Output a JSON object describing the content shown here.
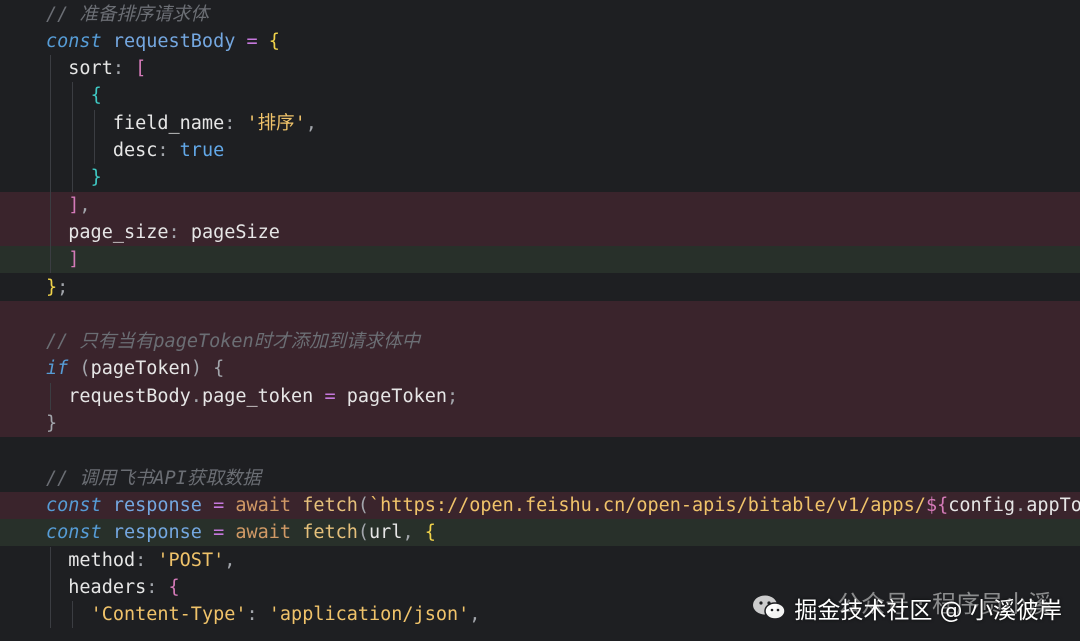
{
  "editor": {
    "lines": [
      {
        "diff": "none",
        "guides": 0,
        "tokens": [
          {
            "t": "// 准备排序请求体",
            "c": "comment"
          }
        ]
      },
      {
        "diff": "none",
        "guides": 0,
        "tokens": [
          {
            "t": "const ",
            "c": "keyword"
          },
          {
            "t": "requestBody",
            "c": "var-blue"
          },
          {
            "t": " = ",
            "c": "op"
          },
          {
            "t": "{",
            "c": "brace-gold"
          }
        ]
      },
      {
        "diff": "none",
        "guides": 1,
        "tokens": [
          {
            "t": "  sort",
            "c": "prop"
          },
          {
            "t": ": ",
            "c": "punct"
          },
          {
            "t": "[",
            "c": "brace-pink"
          }
        ]
      },
      {
        "diff": "none",
        "guides": 2,
        "tokens": [
          {
            "t": "    ",
            "c": "var"
          },
          {
            "t": "{",
            "c": "brace-teal"
          }
        ]
      },
      {
        "diff": "none",
        "guides": 3,
        "tokens": [
          {
            "t": "      field_name",
            "c": "prop"
          },
          {
            "t": ": ",
            "c": "punct"
          },
          {
            "t": "'排序'",
            "c": "string"
          },
          {
            "t": ",",
            "c": "punct"
          }
        ]
      },
      {
        "diff": "none",
        "guides": 3,
        "tokens": [
          {
            "t": "      desc",
            "c": "prop"
          },
          {
            "t": ": ",
            "c": "punct"
          },
          {
            "t": "true",
            "c": "bool"
          }
        ]
      },
      {
        "diff": "none",
        "guides": 2,
        "tokens": [
          {
            "t": "    ",
            "c": "var"
          },
          {
            "t": "}",
            "c": "brace-teal"
          }
        ]
      },
      {
        "diff": "del",
        "guides": 1,
        "tokens": [
          {
            "t": "  ",
            "c": "var"
          },
          {
            "t": "]",
            "c": "brace-pink"
          },
          {
            "t": ",",
            "c": "punct"
          }
        ]
      },
      {
        "diff": "del",
        "guides": 1,
        "tokens": [
          {
            "t": "  page_size",
            "c": "prop"
          },
          {
            "t": ": ",
            "c": "punct"
          },
          {
            "t": "pageSize",
            "c": "var"
          }
        ]
      },
      {
        "diff": "add",
        "guides": 1,
        "tokens": [
          {
            "t": "  ",
            "c": "var"
          },
          {
            "t": "]",
            "c": "brace-pink"
          }
        ]
      },
      {
        "diff": "none",
        "guides": 0,
        "tokens": [
          {
            "t": "}",
            "c": "brace-gold"
          },
          {
            "t": ";",
            "c": "punct"
          }
        ]
      },
      {
        "diff": "del",
        "guides": 0,
        "tokens": [
          {
            "t": "",
            "c": "var"
          }
        ]
      },
      {
        "diff": "del",
        "guides": 0,
        "tokens": [
          {
            "t": "// 只有当有pageToken时才添加到请求体中",
            "c": "comment"
          }
        ]
      },
      {
        "diff": "del",
        "guides": 0,
        "tokens": [
          {
            "t": "if",
            "c": "keyword"
          },
          {
            "t": " (",
            "c": "punct"
          },
          {
            "t": "pageToken",
            "c": "var"
          },
          {
            "t": ") ",
            "c": "punct"
          },
          {
            "t": "{",
            "c": "punct"
          }
        ]
      },
      {
        "diff": "del",
        "guides": 1,
        "tokens": [
          {
            "t": "  requestBody",
            "c": "var"
          },
          {
            "t": ".",
            "c": "punct"
          },
          {
            "t": "page_token",
            "c": "var"
          },
          {
            "t": " = ",
            "c": "op"
          },
          {
            "t": "pageToken",
            "c": "var"
          },
          {
            "t": ";",
            "c": "punct"
          }
        ]
      },
      {
        "diff": "del",
        "guides": 0,
        "tokens": [
          {
            "t": "}",
            "c": "punct"
          }
        ]
      },
      {
        "diff": "none",
        "guides": 0,
        "tokens": [
          {
            "t": "",
            "c": "var"
          }
        ]
      },
      {
        "diff": "none",
        "guides": 0,
        "tokens": [
          {
            "t": "// 调用飞书API获取数据",
            "c": "comment"
          }
        ]
      },
      {
        "diff": "del",
        "guides": 0,
        "tokens": [
          {
            "t": "const ",
            "c": "keyword"
          },
          {
            "t": "response",
            "c": "var-blue"
          },
          {
            "t": " = ",
            "c": "op"
          },
          {
            "t": "await ",
            "c": "kw-await"
          },
          {
            "t": "fetch",
            "c": "fn"
          },
          {
            "t": "(",
            "c": "punct"
          },
          {
            "t": "`https://open.feishu.cn/open-apis/bitable/v1/apps/",
            "c": "url"
          },
          {
            "t": "${",
            "c": "interp"
          },
          {
            "t": "config",
            "c": "var"
          },
          {
            "t": ".",
            "c": "punct"
          },
          {
            "t": "appToken",
            "c": "var"
          }
        ]
      },
      {
        "diff": "add",
        "guides": 0,
        "tokens": [
          {
            "t": "const ",
            "c": "keyword"
          },
          {
            "t": "response",
            "c": "var-blue"
          },
          {
            "t": " = ",
            "c": "op"
          },
          {
            "t": "await ",
            "c": "kw-await"
          },
          {
            "t": "fetch",
            "c": "fn"
          },
          {
            "t": "(",
            "c": "punct"
          },
          {
            "t": "url",
            "c": "var"
          },
          {
            "t": ", ",
            "c": "punct"
          },
          {
            "t": "{",
            "c": "brace-gold"
          }
        ]
      },
      {
        "diff": "none",
        "guides": 1,
        "tokens": [
          {
            "t": "  method",
            "c": "prop"
          },
          {
            "t": ": ",
            "c": "punct"
          },
          {
            "t": "'POST'",
            "c": "string"
          },
          {
            "t": ",",
            "c": "punct"
          }
        ]
      },
      {
        "diff": "none",
        "guides": 1,
        "tokens": [
          {
            "t": "  headers",
            "c": "prop"
          },
          {
            "t": ": ",
            "c": "punct"
          },
          {
            "t": "{",
            "c": "brace-pink"
          }
        ]
      },
      {
        "diff": "none",
        "guides": 2,
        "tokens": [
          {
            "t": "    ",
            "c": "var"
          },
          {
            "t": "'Content-Type'",
            "c": "string"
          },
          {
            "t": ": ",
            "c": "punct"
          },
          {
            "t": "'application/json'",
            "c": "string"
          },
          {
            "t": ",",
            "c": "punct"
          }
        ]
      }
    ]
  },
  "watermark": {
    "line1": "公众号 · 程序员小溪",
    "line2": "掘金技术社区 @ 小溪彼岸",
    "icon": "wechat-icon"
  },
  "colors": {
    "background": "#1e1f22",
    "deleted_line": "#3a242c",
    "added_line": "#28302a"
  }
}
